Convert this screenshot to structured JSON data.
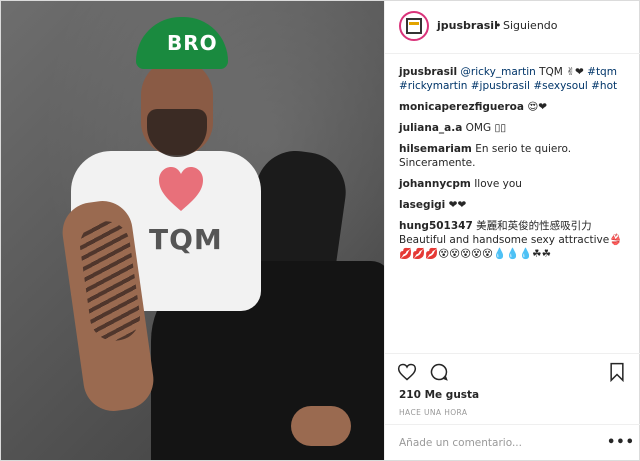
{
  "post": {
    "username": "jpusbrasil",
    "separator": "•",
    "follow_status": "Siguiendo",
    "image_texts": {
      "cap": "BRO",
      "shirt": "TQM"
    }
  },
  "comments": [
    {
      "user": "jpusbrasil",
      "parts": [
        {
          "t": "@ricky_martin",
          "tag": true
        },
        {
          "t": " TQM ",
          "tag": false
        },
        {
          "t": "✌❤ ",
          "tag": false
        },
        {
          "t": "#tqm",
          "tag": true
        },
        {
          "t": " ",
          "tag": false
        },
        {
          "t": "#rickymartin",
          "tag": true
        },
        {
          "t": " ",
          "tag": false
        },
        {
          "t": "#jpusbrasil",
          "tag": true
        },
        {
          "t": " ",
          "tag": false
        },
        {
          "t": "#sexysoul",
          "tag": true
        },
        {
          "t": " ",
          "tag": false
        },
        {
          "t": "#hot",
          "tag": true
        }
      ]
    },
    {
      "user": "monicaperezfigueroa",
      "text": "😍❤"
    },
    {
      "user": "juliana_a.a",
      "text": "OMG ▯▯"
    },
    {
      "user": "hilsemariam",
      "text": "En serio te quiero. Sinceramente."
    },
    {
      "user": "johannycpm",
      "text": "Ilove you"
    },
    {
      "user": "lasegigi",
      "text": "❤❤"
    },
    {
      "user": "hung501347",
      "text": "美麗和英俊的性感吸引力 Beautiful and handsome sexy attractive👙💋💋💋😵😵😵😵😵💧💧💧☘☘"
    }
  ],
  "likes_text": "210 Me gusta",
  "timestamp": "HACE UNA HORA",
  "comment_placeholder": "Añade un comentario...",
  "more_label": "•••",
  "colors": {
    "accent": "#003569",
    "border": "#efefef",
    "muted": "#999999",
    "story_ring": "#d9337a"
  },
  "icons": [
    "heart-icon",
    "comment-icon",
    "bookmark-icon",
    "more-options-icon"
  ]
}
